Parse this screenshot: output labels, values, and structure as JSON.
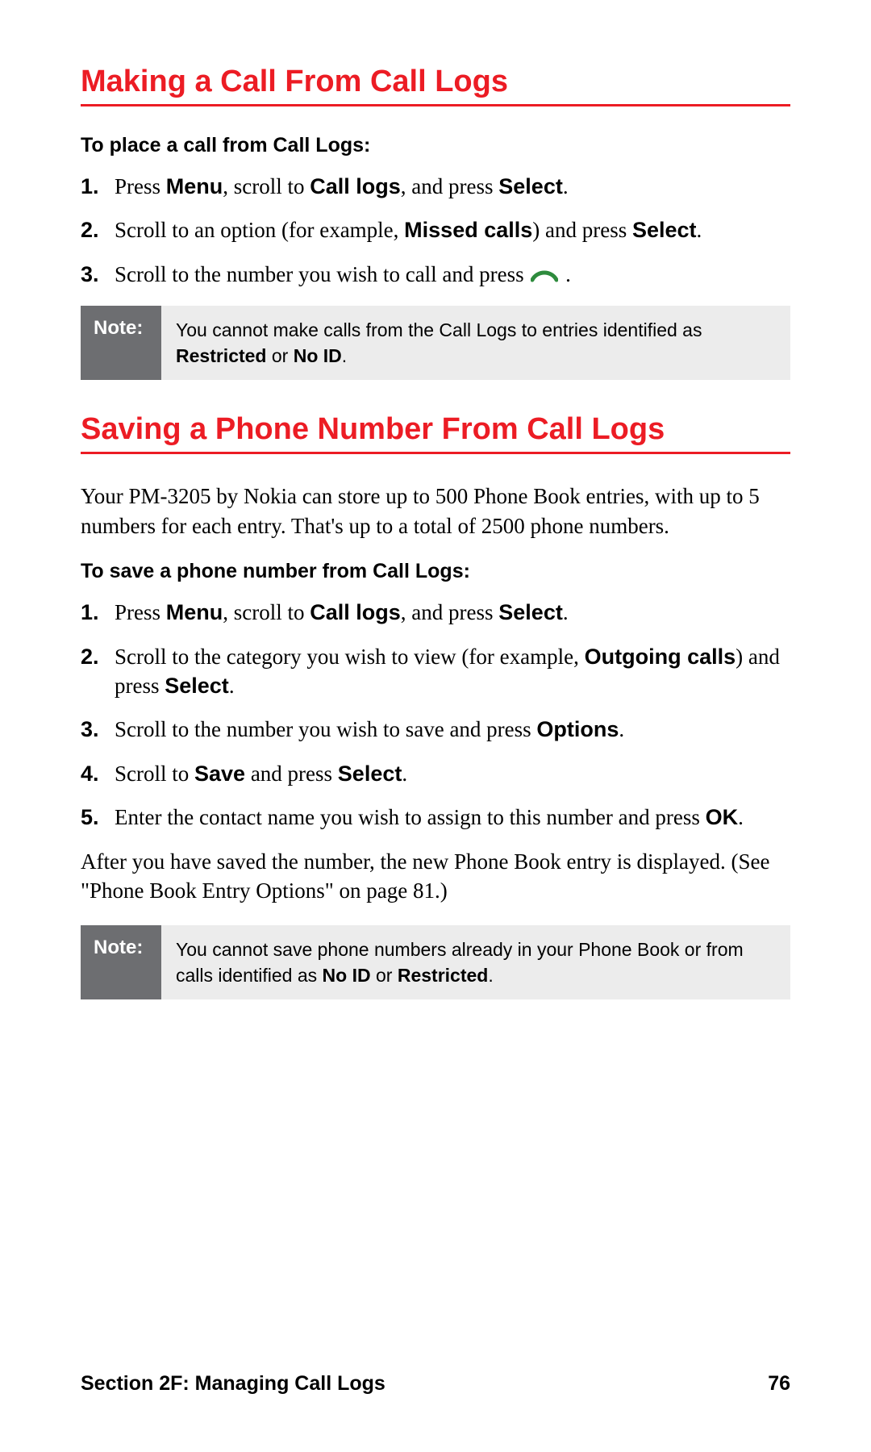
{
  "section1": {
    "heading": "Making a Call From Call Logs",
    "subhead": "To place a call from Call Logs:",
    "steps": {
      "s1a": "Press ",
      "s1b": "Menu",
      "s1c": ", scroll to ",
      "s1d": "Call logs",
      "s1e": ", and press ",
      "s1f": "Select",
      "s1g": ".",
      "s2a": "Scroll to an option (for example, ",
      "s2b": "Missed calls",
      "s2c": ") and press ",
      "s2d": "Select",
      "s2e": ".",
      "s3a": "Scroll to the number you wish to call and press ",
      "s3b": " ."
    },
    "note_label": "Note:",
    "note": {
      "a": "You cannot make calls from the Call Logs to entries identified as ",
      "b": "Restricted",
      "c": " or ",
      "d": "No ID",
      "e": "."
    }
  },
  "section2": {
    "heading": "Saving a Phone Number From Call Logs",
    "intro": "Your PM-3205 by Nokia can store up to 500 Phone Book entries, with up to 5 numbers for each entry. That's up to a total of 2500 phone numbers.",
    "subhead": "To save a phone number from Call Logs:",
    "steps": {
      "s1a": "Press ",
      "s1b": "Menu",
      "s1c": ", scroll to ",
      "s1d": "Call logs",
      "s1e": ", and press ",
      "s1f": "Select",
      "s1g": ".",
      "s2a": "Scroll to the category you wish to view (for example, ",
      "s2b": "Outgoing calls",
      "s2c": ") and press ",
      "s2d": "Select",
      "s2e": ".",
      "s3a": "Scroll to the number you wish to save and press ",
      "s3b": "Options",
      "s3c": ".",
      "s4a": "Scroll to ",
      "s4b": "Save",
      "s4c": " and press ",
      "s4d": "Select",
      "s4e": ".",
      "s5a": "Enter the contact name you wish to assign to this number and press ",
      "s5b": "OK",
      "s5c": "."
    },
    "after": "After you have saved the number, the new Phone Book entry is displayed. (See \"Phone Book Entry Options\" on page 81.)",
    "note_label": "Note:",
    "note": {
      "a": "You cannot save phone numbers already in your Phone Book or from calls identified as ",
      "b": "No ID",
      "c": " or ",
      "d": "Restricted",
      "e": "."
    }
  },
  "footer": {
    "left": "Section 2F: Managing Call Logs",
    "right": "76"
  }
}
